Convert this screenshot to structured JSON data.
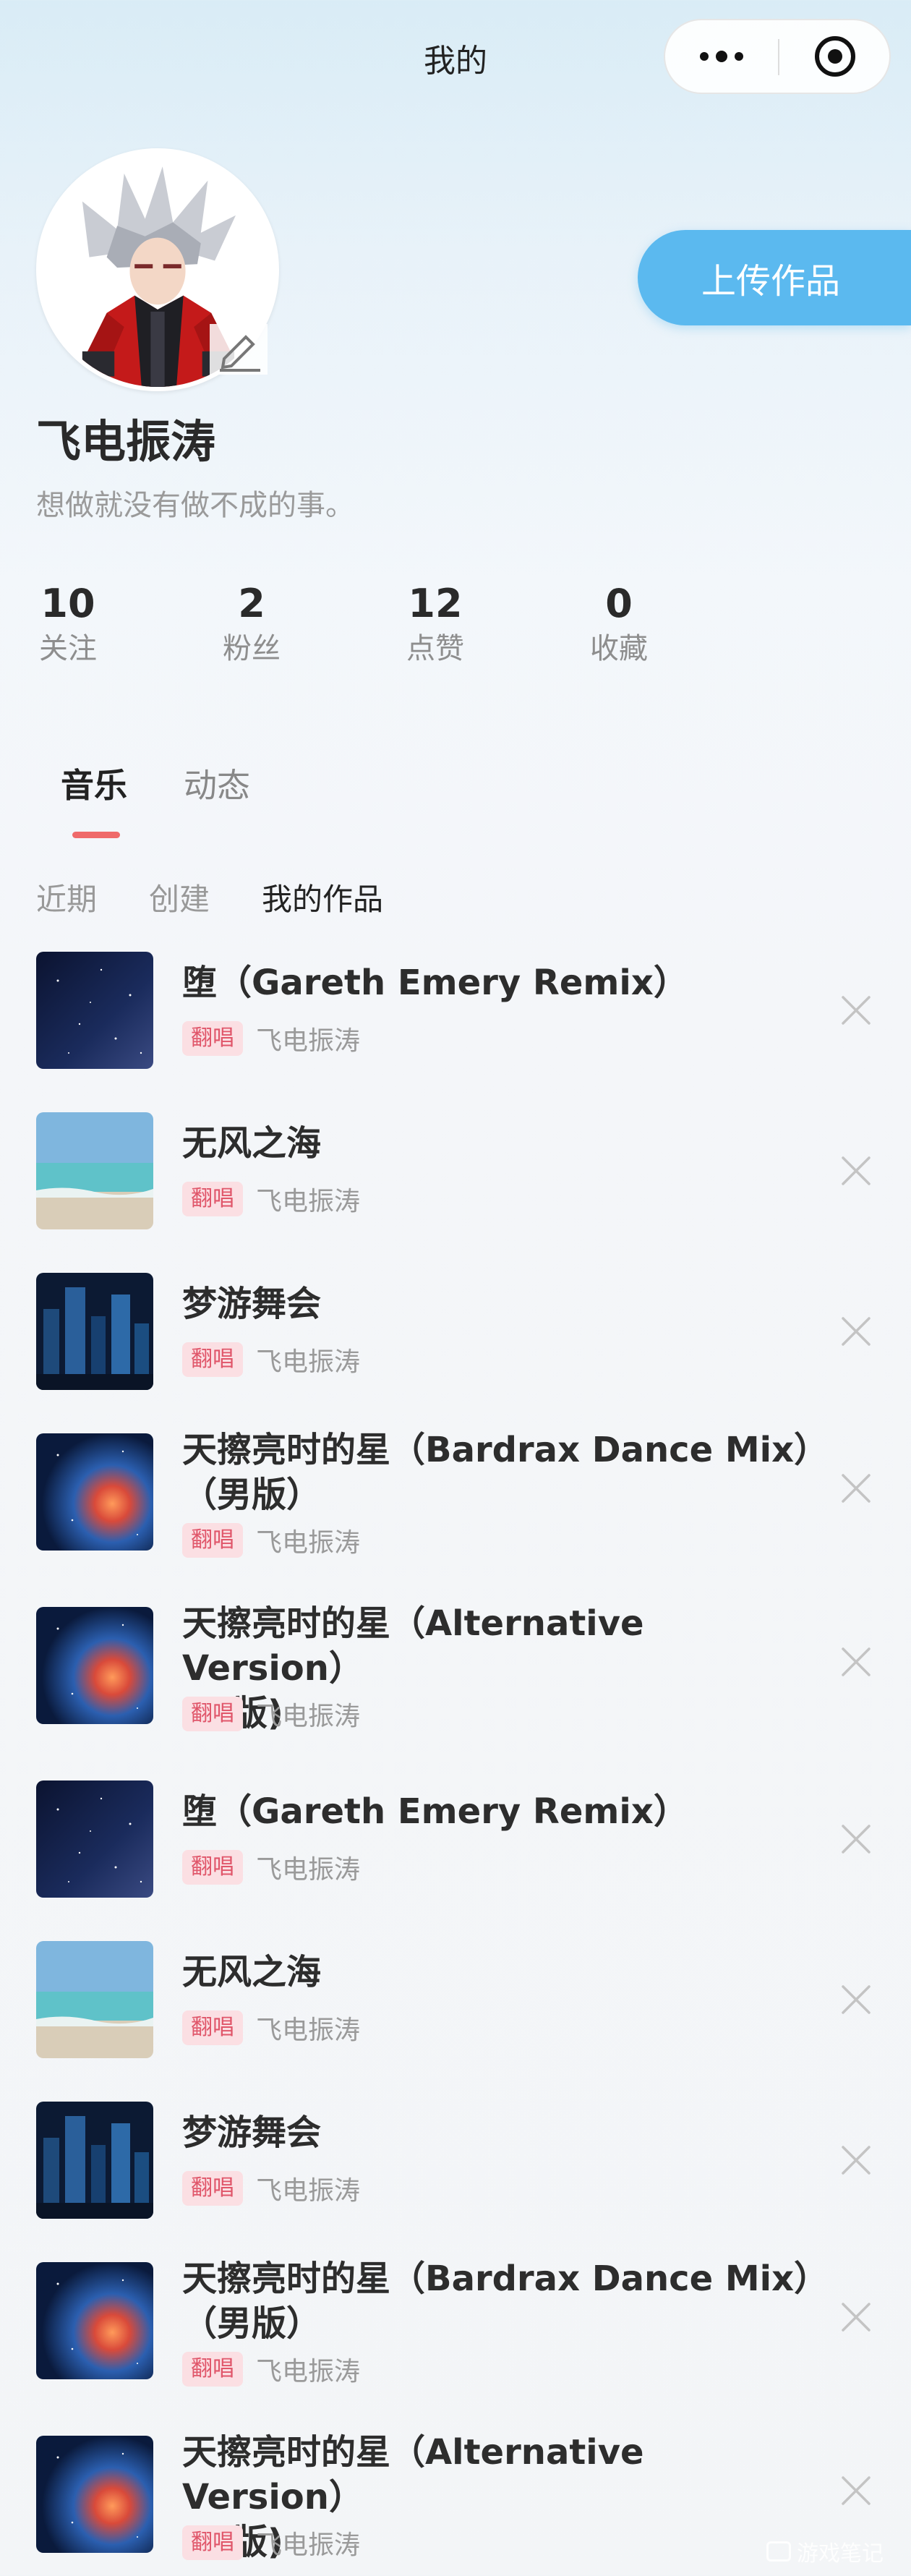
{
  "header": {
    "title": "我的"
  },
  "profile": {
    "username": "飞电振涛",
    "bio": "想做就没有做不成的事。",
    "upload_label": "上传作品"
  },
  "stats": [
    {
      "value": "10",
      "label": "关注"
    },
    {
      "value": "2",
      "label": "粉丝"
    },
    {
      "value": "12",
      "label": "点赞"
    },
    {
      "value": "0",
      "label": "收藏"
    }
  ],
  "tabs": [
    {
      "label": "音乐",
      "active": true
    },
    {
      "label": "动态",
      "active": false
    }
  ],
  "subtabs": [
    {
      "label": "近期",
      "active": false
    },
    {
      "label": "创建",
      "active": false
    },
    {
      "label": "我的作品",
      "active": true
    }
  ],
  "songs": [
    {
      "title_line1": "堕（Gareth Emery Remix）",
      "title_line2": "",
      "tag": "翻唱",
      "artist": "飞电振涛",
      "cover": "stars"
    },
    {
      "title_line1": "无风之海",
      "title_line2": "",
      "tag": "翻唱",
      "artist": "飞电振涛",
      "cover": "sea"
    },
    {
      "title_line1": "梦游舞会",
      "title_line2": "",
      "tag": "翻唱",
      "artist": "飞电振涛",
      "cover": "city"
    },
    {
      "title_line1": "天擦亮时的星（Bardrax Dance Mix）",
      "title_line2": "（男版）",
      "tag": "翻唱",
      "artist": "飞电振涛",
      "cover": "nebula"
    },
    {
      "title_line1": "天擦亮时的星（Alternative Version）",
      "title_line2": "(男版)",
      "tag": "翻唱",
      "artist": "飞电振涛",
      "cover": "nebula"
    },
    {
      "title_line1": "堕（Gareth Emery Remix）",
      "title_line2": "",
      "tag": "翻唱",
      "artist": "飞电振涛",
      "cover": "stars"
    },
    {
      "title_line1": "无风之海",
      "title_line2": "",
      "tag": "翻唱",
      "artist": "飞电振涛",
      "cover": "sea"
    },
    {
      "title_line1": "梦游舞会",
      "title_line2": "",
      "tag": "翻唱",
      "artist": "飞电振涛",
      "cover": "city"
    },
    {
      "title_line1": "天擦亮时的星（Bardrax Dance Mix）",
      "title_line2": "（男版）",
      "tag": "翻唱",
      "artist": "飞电振涛",
      "cover": "nebula"
    },
    {
      "title_line1": "天擦亮时的星（Alternative Version）",
      "title_line2": "(男版)",
      "tag": "翻唱",
      "artist": "飞电振涛",
      "cover": "nebula"
    }
  ],
  "icons": {
    "more": "more-dots-icon",
    "close_miniprogram": "target-circle-icon",
    "edit": "pencil-icon",
    "delete": "close-x-icon"
  },
  "watermark": "游戏笔记",
  "colors": {
    "accent_blue": "#5bb9ef",
    "tab_underline": "#ef6a6a",
    "tag_bg": "#fbdfe3",
    "tag_text": "#e0566a"
  }
}
